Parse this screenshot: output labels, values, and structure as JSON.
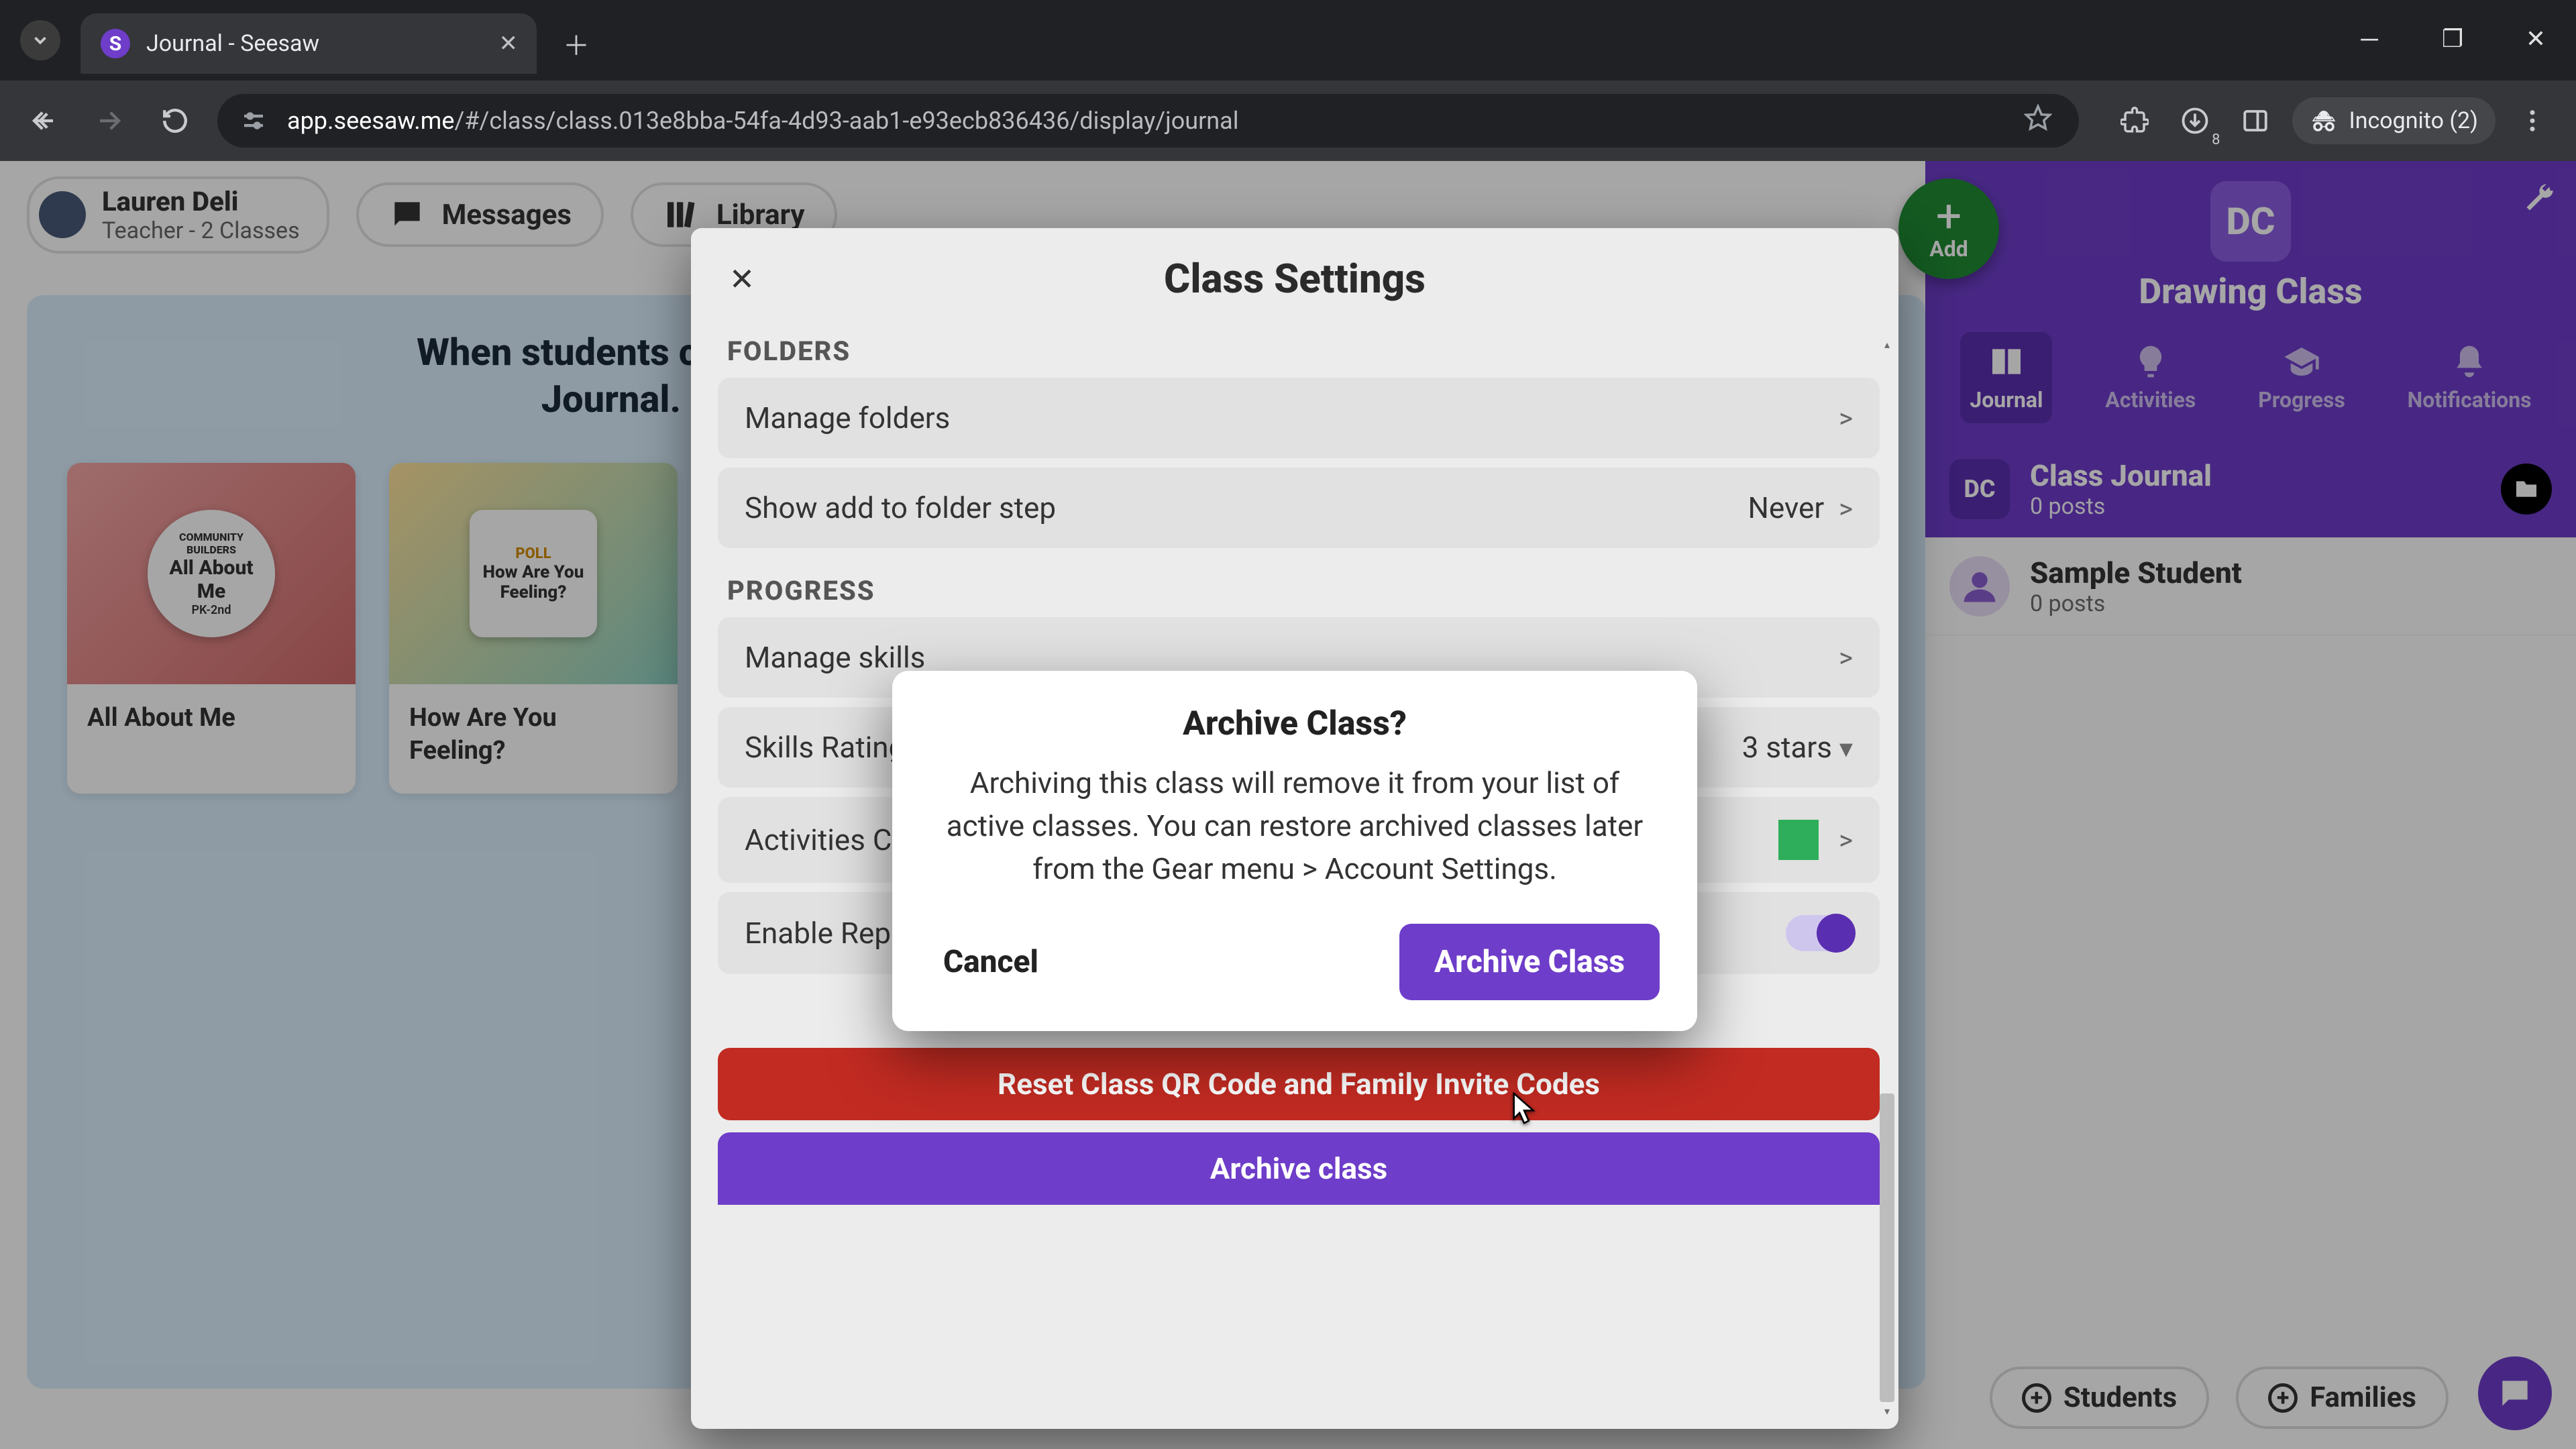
{
  "browser": {
    "tab_title": "Journal - Seesaw",
    "url_host": "app.seesaw.me",
    "url_path": "/#/class/class.013e8bba-54fa-4d93-aab1-e93ecb836436/display/journal",
    "incognito_label": "Incognito (2)",
    "download_badge": "8"
  },
  "user": {
    "name": "Lauren Deli",
    "role": "Teacher - 2 Classes"
  },
  "top_nav": {
    "messages": "Messages",
    "library": "Library"
  },
  "add_button": {
    "label": "Add"
  },
  "hero": {
    "line1": "When students complete activities their work will show here in the",
    "line2": "Journal. Explore activities from the Seesaw Library."
  },
  "cards": [
    {
      "badge_line1": "COMMUNITY",
      "badge_line2": "BUILDERS",
      "badge_line3": "All About",
      "badge_line4": "Me",
      "badge_sub": "PK-2nd",
      "caption": "All About Me"
    },
    {
      "badge_line1": "POLL",
      "badge_line2": "",
      "badge_line3": "How Are You",
      "badge_line4": "Feeling?",
      "badge_sub": "",
      "caption": "How Are You Feeling?"
    }
  ],
  "class_sidebar": {
    "badge": "DC",
    "name": "Drawing Class",
    "tabs": {
      "journal": "Journal",
      "activities": "Activities",
      "progress": "Progress",
      "notifications": "Notifications"
    },
    "feed": [
      {
        "sq": "DC",
        "title": "Class Journal",
        "sub": "0 posts"
      },
      {
        "title": "Sample Student",
        "sub": "0 posts"
      }
    ]
  },
  "bottom_pills": {
    "students": "Students",
    "families": "Families"
  },
  "settings_modal": {
    "title": "Class Settings",
    "sections": {
      "folders_label": "FOLDERS",
      "folders": [
        {
          "label": "Manage folders",
          "trail": ">"
        },
        {
          "label": "Show add to folder step",
          "trail_text": "Never",
          "trail": ">"
        }
      ],
      "progress_label": "PROGRESS",
      "progress": [
        {
          "label": "Manage skills",
          "trail": ">"
        },
        {
          "label": "Skills Rating Scale",
          "trail_text": "3 stars",
          "trail": "▾"
        },
        {
          "label": "Activities Color",
          "trail": ">"
        },
        {
          "label": "Enable Reporting",
          "toggle": true
        }
      ]
    },
    "reset_btn": "Reset Class QR Code and Family Invite Codes",
    "archive_btn": "Archive class"
  },
  "confirm_dialog": {
    "title": "Archive Class?",
    "body": "Archiving this class will remove it from your list of active classes. You can restore archived classes later from the Gear menu > Account Settings.",
    "cancel": "Cancel",
    "confirm": "Archive Class"
  }
}
